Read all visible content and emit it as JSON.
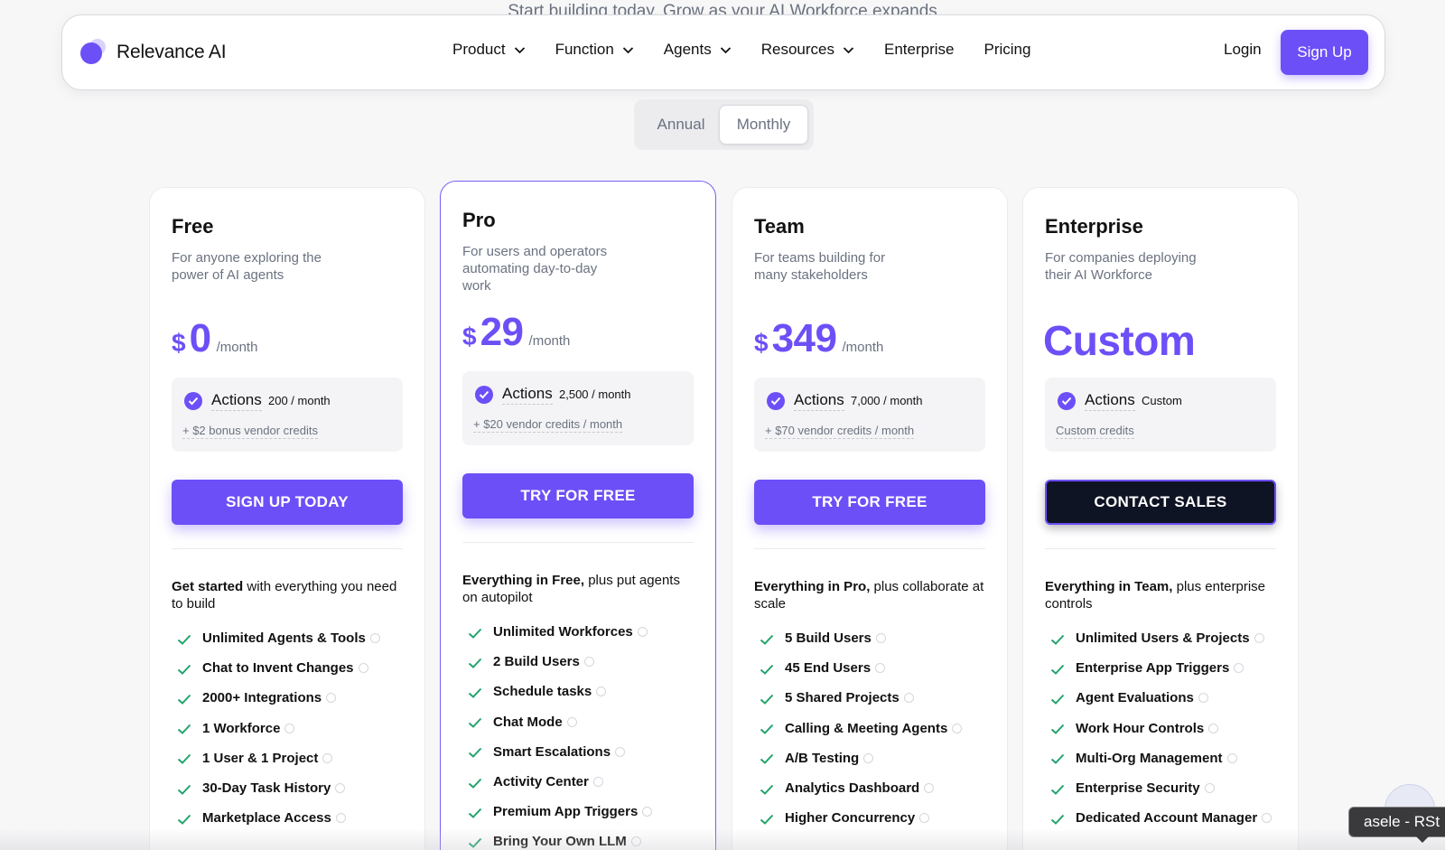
{
  "header_clip": "Start building today. Grow as your AI Workforce expands",
  "brand": {
    "name": "Relevance AI",
    "accent": "#6d4ff7"
  },
  "nav": {
    "items": [
      {
        "label": "Product",
        "dropdown": true
      },
      {
        "label": "Function",
        "dropdown": true
      },
      {
        "label": "Agents",
        "dropdown": true
      },
      {
        "label": "Resources",
        "dropdown": true
      },
      {
        "label": "Enterprise",
        "dropdown": false
      },
      {
        "label": "Pricing",
        "dropdown": false
      }
    ],
    "login": "Login",
    "signup": "Sign Up"
  },
  "billing_toggle": {
    "annual": "Annual",
    "monthly": "Monthly",
    "selected": "Monthly"
  },
  "plans": [
    {
      "name": "Free",
      "desc": "For anyone exploring the power of AI agents",
      "currency": "$",
      "amount": "0",
      "period": "/month",
      "actions_label": "Actions",
      "actions_qty": "200 / month",
      "actions_sub": "+ $2 bonus vendor credits",
      "cta": "SIGN UP TODAY",
      "feature_head_bold": "Get started",
      "feature_head_rest": " with everything you need to build",
      "features": [
        "Unlimited Agents & Tools",
        "Chat to Invent Changes",
        "2000+ Integrations",
        "1 Workforce",
        "1 User & 1 Project",
        "30-Day Task History",
        "Marketplace Access"
      ]
    },
    {
      "name": "Pro",
      "desc": "For users and operators automating day-to-day work",
      "currency": "$",
      "amount": "29",
      "period": "/month",
      "actions_label": "Actions",
      "actions_qty": "2,500 / month",
      "actions_sub": "+ $20 vendor credits / month",
      "cta": "TRY FOR FREE",
      "feature_head_bold": "Everything in Free,",
      "feature_head_rest": " plus put agents on autopilot",
      "features": [
        "Unlimited Workforces",
        "2 Build Users",
        "Schedule tasks",
        "Chat Mode",
        "Smart Escalations",
        "Activity Center",
        "Premium App Triggers",
        "Bring Your Own LLM"
      ]
    },
    {
      "name": "Team",
      "desc": "For teams building for many stakeholders",
      "currency": "$",
      "amount": "349",
      "period": "/month",
      "actions_label": "Actions",
      "actions_qty": "7,000 / month",
      "actions_sub": "+ $70 vendor credits / month",
      "cta": "TRY FOR FREE",
      "feature_head_bold": "Everything in Pro,",
      "feature_head_rest": " plus collaborate at scale",
      "features": [
        "5 Build Users",
        "45 End Users",
        "5 Shared Projects",
        "Calling & Meeting Agents",
        "A/B Testing",
        "Analytics Dashboard",
        "Higher Concurrency"
      ]
    },
    {
      "name": "Enterprise",
      "desc": "For companies deploying their AI Workforce",
      "currency": "",
      "amount": "Custom",
      "period": "",
      "actions_label": "Actions",
      "actions_qty": "Custom",
      "actions_sub": "Custom credits",
      "cta": "CONTACT SALES",
      "feature_head_bold": "Everything in Team,",
      "feature_head_rest": " plus enterprise controls",
      "features": [
        "Unlimited Users & Projects",
        "Enterprise App Triggers",
        "Agent Evaluations",
        "Work Hour Controls",
        "Multi-Org Management",
        "Enterprise Security",
        "Dedicated Account Manager"
      ]
    }
  ],
  "tooltip": "asele - RSt"
}
